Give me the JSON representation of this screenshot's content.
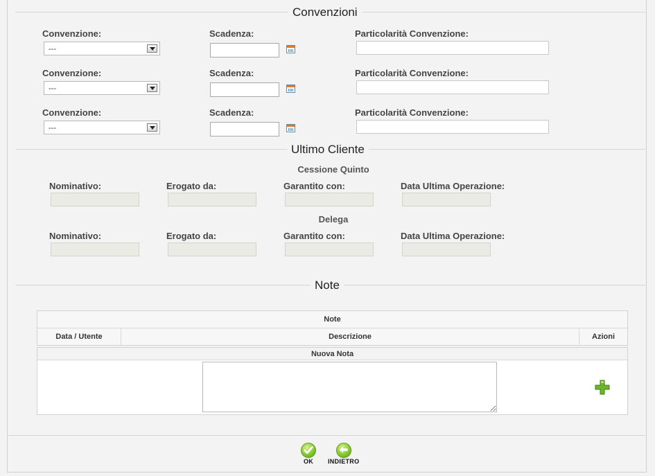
{
  "convenzioni": {
    "title": "Convenzioni",
    "rows": [
      {
        "convenzione_label": "Convenzione:",
        "convenzione_value": "---",
        "scadenza_label": "Scadenza:",
        "particolarita_label": "Particolarità Convenzione:"
      },
      {
        "convenzione_label": "Convenzione:",
        "convenzione_value": "---",
        "scadenza_label": "Scadenza:",
        "particolarita_label": "Particolarità Convenzione:"
      },
      {
        "convenzione_label": "Convenzione:",
        "convenzione_value": "---",
        "scadenza_label": "Scadenza:",
        "particolarita_label": "Particolarità Convenzione:"
      }
    ]
  },
  "ultimo_cliente": {
    "title": "Ultimo Cliente",
    "groups": [
      {
        "heading": "Cessione Quinto",
        "nominativo": "Nominativo:",
        "erogato": "Erogato da:",
        "garantito": "Garantito con:",
        "data": "Data Ultima Operazione:"
      },
      {
        "heading": "Delega",
        "nominativo": "Nominativo:",
        "erogato": "Erogato da:",
        "garantito": "Garantito con:",
        "data": "Data Ultima Operazione:"
      }
    ]
  },
  "note": {
    "title": "Note",
    "table_title": "Note",
    "col_data_utente": "Data / Utente",
    "col_descrizione": "Descrizione",
    "col_azioni": "Azioni",
    "nuova_nota": "Nuova Nota"
  },
  "actions": {
    "ok": "OK",
    "indietro": "INDIETRO"
  },
  "colors": {
    "accent_green": "#6cb52a",
    "calendar_blue": "#5b8db8"
  }
}
